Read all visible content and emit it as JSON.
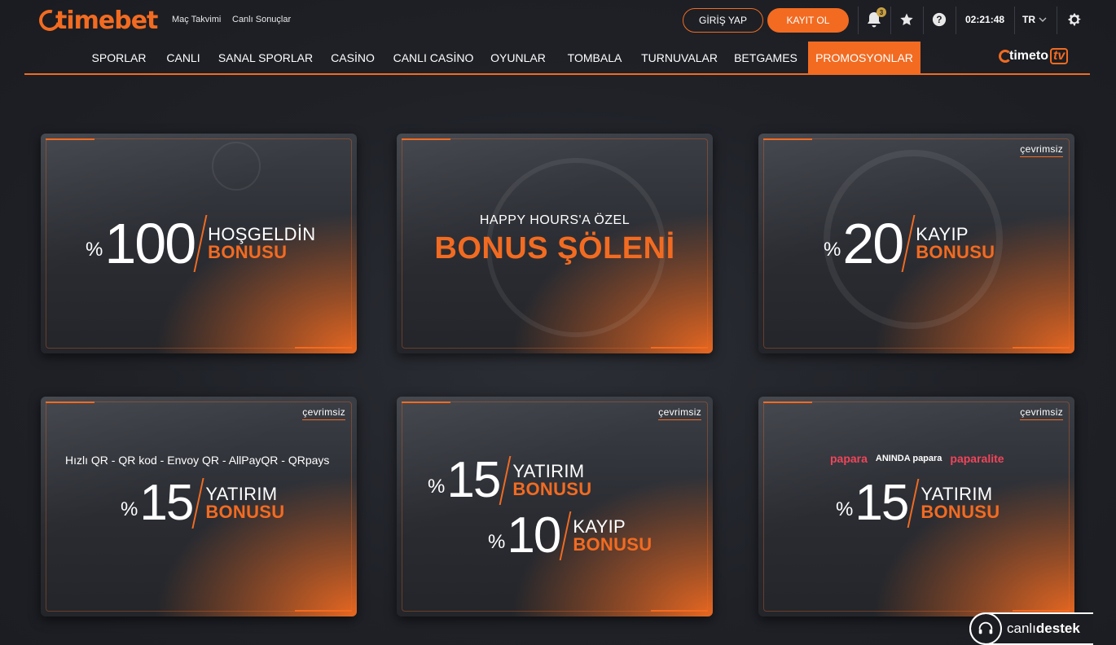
{
  "header": {
    "logo_text": "timebet",
    "links": [
      "Maç Takvimi",
      "Canlı Sonuçlar"
    ],
    "login_label": "GİRİŞ YAP",
    "register_label": "KAYIT OL",
    "notification_count": "3",
    "clock": "02:21:48",
    "language": "TR",
    "icons": [
      "bell-icon",
      "star-icon",
      "help-icon",
      "settings-icon"
    ]
  },
  "nav": {
    "items": [
      "SPORLAR",
      "CANLI",
      "SANAL SPORLAR",
      "CASİNO",
      "CANLI CASİNO",
      "OYUNLAR",
      "TOMBALA",
      "TURNUVALAR",
      "BETGAMES",
      "PROMOSYONLAR"
    ],
    "active": "PROMOSYONLAR",
    "timetotv": {
      "brand": "timeto",
      "suffix": "tv"
    }
  },
  "promos": {
    "card1": {
      "percent": "%",
      "amount": "100",
      "line1": "HOŞGELDİN",
      "line2": "BONUSU"
    },
    "card2": {
      "subtitle": "HAPPY HOURS'A ÖZEL",
      "title": "BONUS ŞÖLENİ"
    },
    "card3": {
      "tag": "çevrimsiz",
      "percent": "%",
      "amount": "20",
      "line1": "KAYIP",
      "line2": "BONUSU"
    },
    "card4": {
      "tag": "çevrimsiz",
      "methods": "Hızlı QR - QR kod - Envoy QR - AllPayQR - QRpays",
      "percent": "%",
      "amount": "15",
      "line1": "YATIRIM",
      "line2": "BONUSU"
    },
    "card5": {
      "tag": "çevrimsiz",
      "percent_a": "%",
      "amount_a": "15",
      "line1_a": "YATIRIM",
      "line2_a": "BONUSU",
      "percent_b": "%",
      "amount_b": "10",
      "line1_b": "KAYIP",
      "line2_b": "BONUSU"
    },
    "card6": {
      "tag": "çevrimsiz",
      "pay1": "papara",
      "pay2": "ANINDA papara",
      "pay3": "paparalite",
      "percent": "%",
      "amount": "15",
      "line1": "YATIRIM",
      "line2": "BONUSU"
    }
  },
  "support": {
    "text_light": "canlı",
    "text_bold": "destek"
  },
  "colors": {
    "accent": "#f26b21",
    "background": "#1f2127",
    "card": "#2a2c32"
  }
}
